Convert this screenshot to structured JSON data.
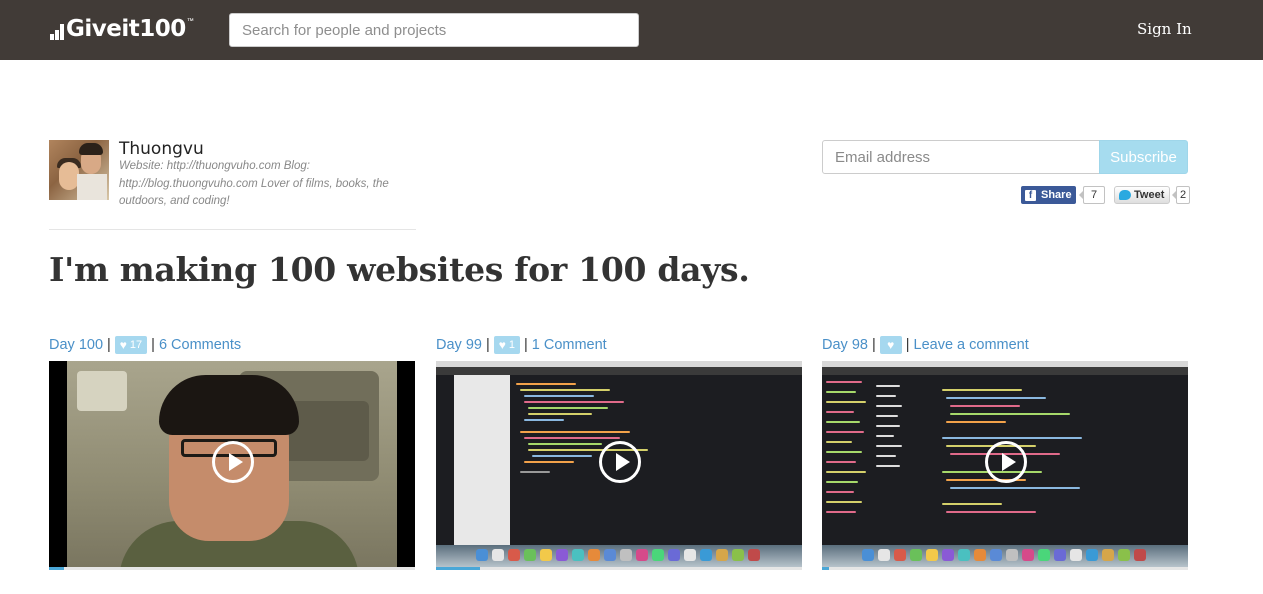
{
  "header": {
    "logo_text": "Giveit100",
    "logo_tm": "™",
    "search_placeholder": "Search for people and projects",
    "signin_label": "Sign In"
  },
  "profile": {
    "username": "Thuongvu",
    "bio": "Website: http://thuongvuho.com Blog: http://blog.thuongvuho.com Lover of films, books, the outdoors, and coding!",
    "email_placeholder": "Email address",
    "subscribe_label": "Subscribe",
    "facebook": {
      "label": "Share",
      "icon": "f",
      "count": "7"
    },
    "twitter": {
      "label": "Tweet",
      "count": "2"
    }
  },
  "headline": "I'm making 100 websites for 100 days.",
  "projects": [
    {
      "day_label": "Day 100",
      "likes": "17",
      "comments_label": "6 Comments",
      "progress": 0.04
    },
    {
      "day_label": "Day 99",
      "likes": "1",
      "comments_label": "1 Comment",
      "progress": 0.12
    },
    {
      "day_label": "Day 98",
      "likes": "",
      "comments_label": "Leave a comment",
      "progress": 0.02
    }
  ],
  "colors": {
    "topbar": "#413b37",
    "link": "#4a90c8",
    "like_badge": "#a6d8ef",
    "subscribe": "#a6dcef",
    "facebook": "#3b5998"
  },
  "icons": [
    "play-icon",
    "heart-icon",
    "facebook-icon",
    "twitter-bird-icon",
    "logo-bars-icon"
  ]
}
